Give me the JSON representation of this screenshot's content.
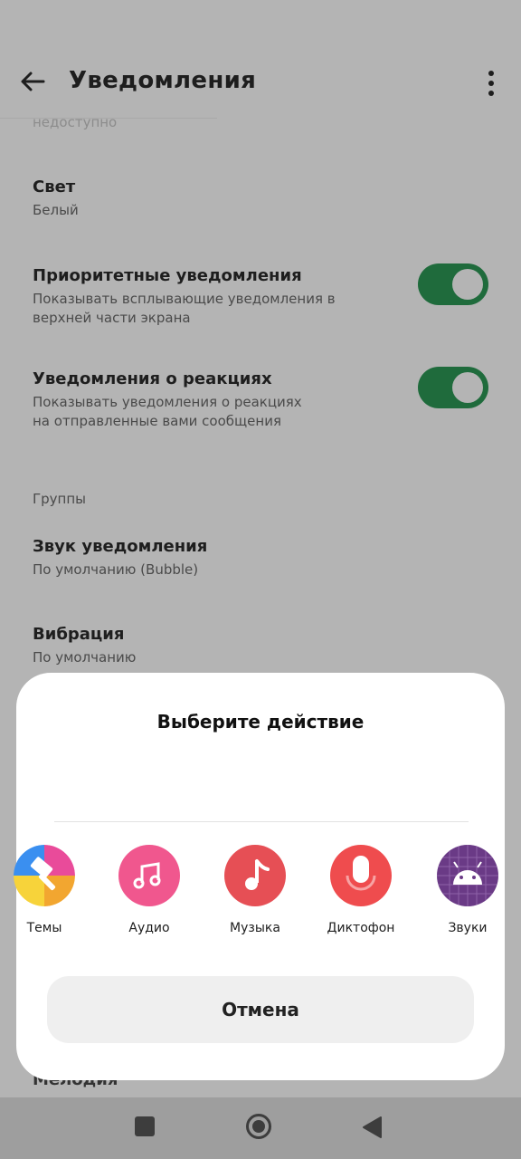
{
  "header": {
    "title": "Уведомления",
    "cutoff_text": "недоступно"
  },
  "settings": [
    {
      "label": "Свет",
      "sub": "Белый"
    },
    {
      "label": "Приоритетные уведомления",
      "sub_line1": "Показывать всплывающие уведомления в",
      "sub_line2": "верхней части экрана",
      "toggle": "on"
    },
    {
      "label": "Уведомления о реакциях",
      "sub_line1": "Показывать уведомления о реакциях",
      "sub_line2": "на отправленные вами сообщения",
      "toggle": "on"
    },
    {
      "label": "Звук уведомления",
      "sub": "По умолчанию (Bubble)"
    },
    {
      "label": "Вибрация",
      "sub": "По умолчанию"
    }
  ],
  "section_groups": "Группы",
  "peek_label": "Мелодия",
  "sheet": {
    "title": "Выберите действие",
    "apps": [
      {
        "name": "Темы",
        "icon": "themes-icon"
      },
      {
        "name": "Аудио",
        "icon": "audio-icon"
      },
      {
        "name": "Музыка",
        "icon": "music-icon"
      },
      {
        "name": "Диктофон",
        "icon": "recorder-icon"
      },
      {
        "name": "Звуки",
        "icon": "android-sounds-icon"
      }
    ],
    "cancel": "Отмена"
  },
  "colors": {
    "toggle_on": "#1f6b3c",
    "audio": "#f0578e",
    "music": "#e64f55",
    "recorder": "#ef4c4e",
    "sounds": "#6a3a86"
  }
}
